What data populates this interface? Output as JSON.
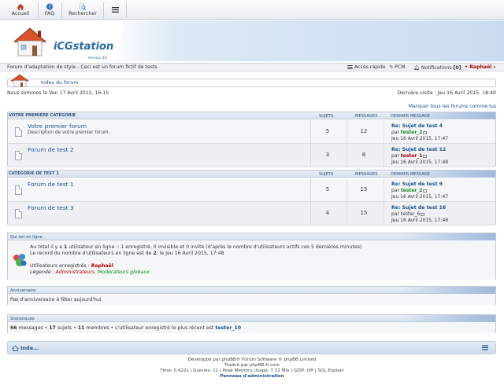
{
  "nav": {
    "accueil": "Accueil",
    "faq": "FAQ",
    "rechercher": "Rechercher"
  },
  "logo": {
    "name": "iCGstation",
    "version": "Version 18"
  },
  "subbar": {
    "site_desc": "Forum d'adaptation de style - Ceci est un forum fictif de tests",
    "acces_rapide": "Accès rapide",
    "pcm": "PCM",
    "notifications": "Notifications",
    "notif_count": "[0]",
    "user": "Raphaël"
  },
  "breadcrumb": {
    "index": "Index du forum"
  },
  "dates": {
    "now": "Nous sommes le Ven 17 Avril 2015, 16:15",
    "last_visit": "Dernière visite : Jeu 16 Avril 2015, 18:40"
  },
  "mark_read": "Marquer tous les forums comme lus",
  "columns": {
    "sujets": "SUJETS",
    "messages": "MESSAGES",
    "dernier": "DERNIER MESSAGE"
  },
  "categories": [
    {
      "name": "VOTRE PREMIÈRE CATÉGORIE",
      "forums": [
        {
          "title": "Votre premier forum",
          "desc": "Description de votre premier forum.",
          "sujets": "5",
          "messages": "12",
          "lp_title": "Re: Sujet de test 4",
          "lp_par": "par",
          "lp_user": "tester_2",
          "lp_date": "Jeu 16 Avril 2015, 17:47"
        },
        {
          "title": "Forum de test 2",
          "desc": "",
          "sujets": "3",
          "messages": "8",
          "lp_title": "Re: Sujet de test 12",
          "lp_par": "par",
          "lp_user": "tester_1",
          "lp_date": "Jeu 16 Avril 2015, 17:48"
        }
      ]
    },
    {
      "name": "CATÉGORIE DE TEST 1",
      "forums": [
        {
          "title": "Forum de test 1",
          "desc": "",
          "sujets": "5",
          "messages": "15",
          "lp_title": "Re: Sujet de test 9",
          "lp_par": "par",
          "lp_user": "tester_2",
          "lp_date": "Jeu 16 Avril 2015, 17:47"
        },
        {
          "title": "Forum de test 3",
          "desc": "",
          "sujets": "4",
          "messages": "15",
          "lp_title": "Re: Sujet de test 16",
          "lp_par": "par",
          "lp_user": "tester_6",
          "lp_date": "Jeu 16 Avril 2015, 17:48"
        }
      ]
    }
  ],
  "online": {
    "title": "Qui est en ligne",
    "line1_a": "Au total il y a",
    "line1_n": "1",
    "line1_b": "utilisateur en ligne :: 1 enregistré, 0 invisible et 0 invité (d'après le nombre d'utilisateurs actifs ces 5 dernières minutes)",
    "line2_a": "Le record du nombre d'utilisateurs en ligne est de",
    "line2_n": "2",
    "line2_b": ", le Jeu 16 Avril 2015, 17:48",
    "registered_label": "Utilisateurs enregistrés :",
    "registered_user": "Raphaël",
    "legend_label": "Légende :",
    "legend_admin": "Administrateurs",
    "legend_sep": ",",
    "legend_mod": "Modérateurs globaux"
  },
  "birthdays": {
    "title": "Anniversaire",
    "text": "Pas d'anniversaire à fêter aujourd'hui"
  },
  "stats": {
    "title": "Statistiques",
    "messages_n": "66",
    "messages_l": "messages",
    "sujets_n": "17",
    "sujets_l": "sujets",
    "membres_n": "11",
    "membres_l": "membres",
    "newest_l": "L'utilisateur enregistré le plus récent est",
    "newest_user": "tester_10"
  },
  "bottom": {
    "index": "Inde..."
  },
  "footer": {
    "line1": "Développé par phpBB® Forum Software © phpBB Limited",
    "line2": "Traduit par phpBB-fr.com",
    "line3": "Time: 0.422s | Queries: 11 | Peak Memory Usage: 7.31 Mio | GZIP: Off | SQL Explain",
    "admin": "Panneau d'administration"
  },
  "colors": {
    "link": "#1c4f8a",
    "admin_red": "#aa0000",
    "mod_green": "#11871c",
    "header_blue": "#c9dcef"
  }
}
